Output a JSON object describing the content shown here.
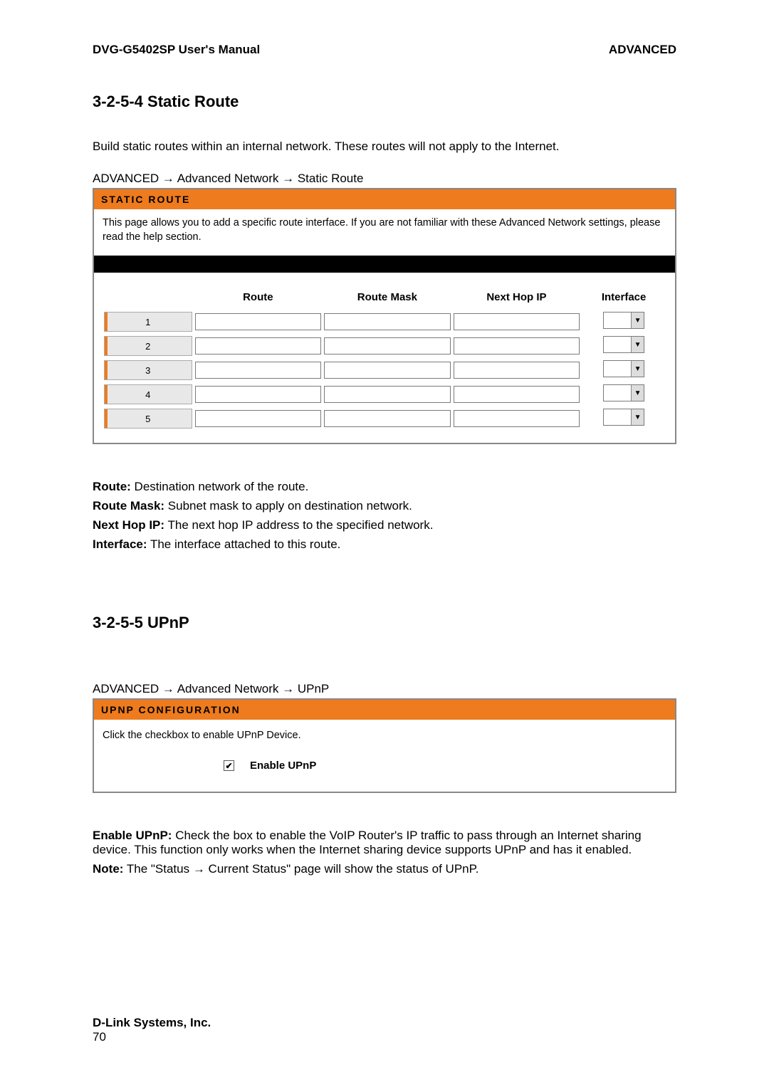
{
  "header": {
    "manual_title": "DVG-G5402SP User's Manual",
    "section_tag": "ADVANCED"
  },
  "static_route": {
    "heading": "3-2-5-4 Static Route",
    "intro": "Build static routes within an internal network. These routes will not apply to the Internet.",
    "breadcrumb": "ADVANCED  →  Advanced Network  →  Static Route",
    "panel_title": "STATIC ROUTE",
    "panel_desc": "This page allows you to add a specific route interface. If you are not familiar with these Advanced Network settings, please read the help section.",
    "columns": [
      "Route",
      "Route Mask",
      "Next Hop IP",
      "Interface"
    ],
    "rows": [
      {
        "n": "1",
        "route": "",
        "mask": "",
        "nexthop": "",
        "iface": ""
      },
      {
        "n": "2",
        "route": "",
        "mask": "",
        "nexthop": "",
        "iface": ""
      },
      {
        "n": "3",
        "route": "",
        "mask": "",
        "nexthop": "",
        "iface": ""
      },
      {
        "n": "4",
        "route": "",
        "mask": "",
        "nexthop": "",
        "iface": ""
      },
      {
        "n": "5",
        "route": "",
        "mask": "",
        "nexthop": "",
        "iface": ""
      }
    ],
    "definitions": {
      "route_label": "Route:",
      "route_text": " Destination network of the route.",
      "mask_label": "Route Mask:",
      "mask_text": " Subnet mask to apply on destination network.",
      "nexthop_label": "Next Hop IP:",
      "nexthop_text": " The next hop IP address to the specified network.",
      "iface_label": "Interface:",
      "iface_text": " The interface attached to this route."
    }
  },
  "upnp": {
    "heading": "3-2-5-5 UPnP",
    "breadcrumb": "ADVANCED  →  Advanced Network  →  UPnP",
    "panel_title": "UPNP CONFIGURATION",
    "panel_desc": "Click the checkbox to enable UPnP Device.",
    "enable_label": "Enable UPnP",
    "enable_checked": true,
    "enable_def_label": "Enable UPnP:",
    "enable_def_text": " Check the box to enable the VoIP Router's IP traffic to pass through an Internet sharing device. This function only works when the Internet sharing device supports UPnP and has it enabled.",
    "note_label": "Note:",
    "note_text": " The \"Status → Current Status\" page will show the status of UPnP."
  },
  "footer": {
    "company": "D-Link Systems, Inc.",
    "page_number": "70"
  }
}
